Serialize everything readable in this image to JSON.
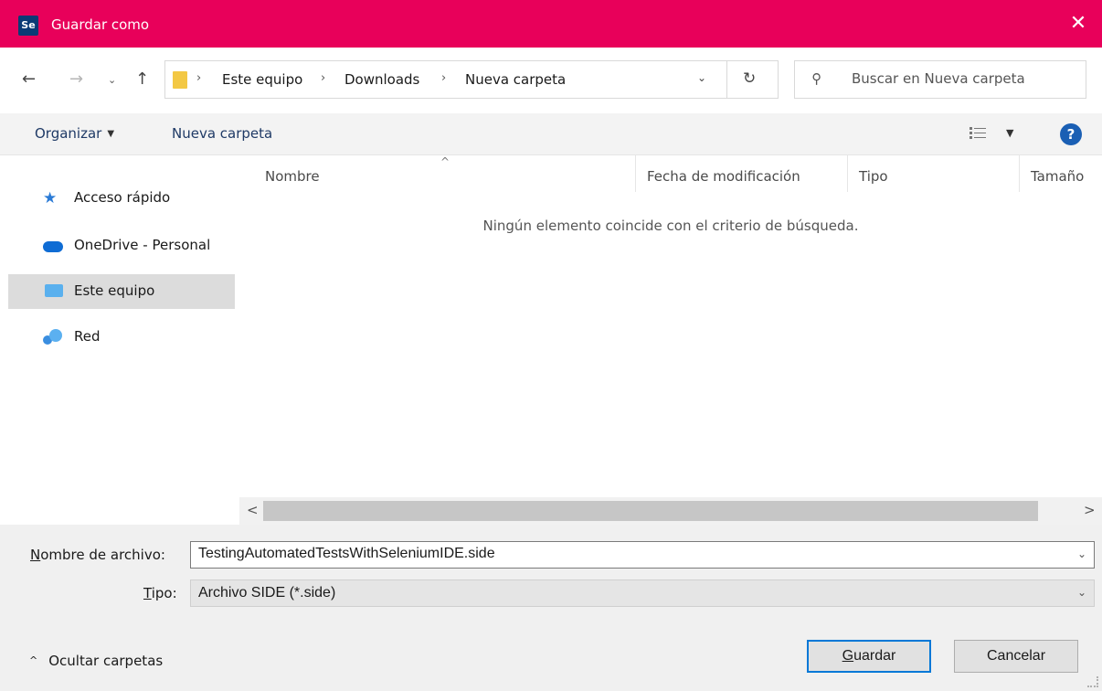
{
  "window": {
    "title": "Guardar como",
    "app_icon_text": "Se",
    "close_glyph": "✕",
    "accent_color": "#e8005a"
  },
  "nav": {
    "back_glyph": "←",
    "forward_glyph": "→",
    "recent_glyph": "⌄",
    "up_glyph": "↑",
    "breadcrumbs": [
      "Este equipo",
      "Downloads",
      "Nueva carpeta"
    ],
    "separator_glyph": "›",
    "dropdown_glyph": "⌄",
    "refresh_glyph": "↻"
  },
  "search": {
    "placeholder": "Buscar en Nueva carpeta",
    "icon": "search-icon"
  },
  "command_bar": {
    "organize_label": "Organizar",
    "new_folder_label": "Nueva carpeta",
    "help_label": "?"
  },
  "sidebar": {
    "items": [
      {
        "label": "Acceso rápido",
        "icon": "star-icon",
        "selected": false
      },
      {
        "label": "OneDrive - Personal",
        "icon": "cloud-icon",
        "selected": false
      },
      {
        "label": "Este equipo",
        "icon": "computer-icon",
        "selected": true
      },
      {
        "label": "Red",
        "icon": "network-icon",
        "selected": false
      }
    ]
  },
  "file_list": {
    "columns": [
      "Nombre",
      "Fecha de modificación",
      "Tipo",
      "Tamaño"
    ],
    "sort_glyph": "^",
    "empty_message": "Ningún elemento coincide con el criterio de búsqueda.",
    "scroll_left_glyph": "<",
    "scroll_right_glyph": ">"
  },
  "form": {
    "filename_label_underlined": "N",
    "filename_label_rest": "ombre de archivo:",
    "filename_value": "TestingAutomatedTestsWithSeleniumIDE.side",
    "type_label_underlined": "T",
    "type_label_rest": "ipo:",
    "type_value": "Archivo SIDE (*.side)",
    "combo_glyph": "⌄"
  },
  "footer": {
    "hide_folders_label": "Ocultar carpetas",
    "hide_glyph": "^",
    "save_underlined": "G",
    "save_rest": "uardar",
    "cancel_label": "Cancelar"
  }
}
